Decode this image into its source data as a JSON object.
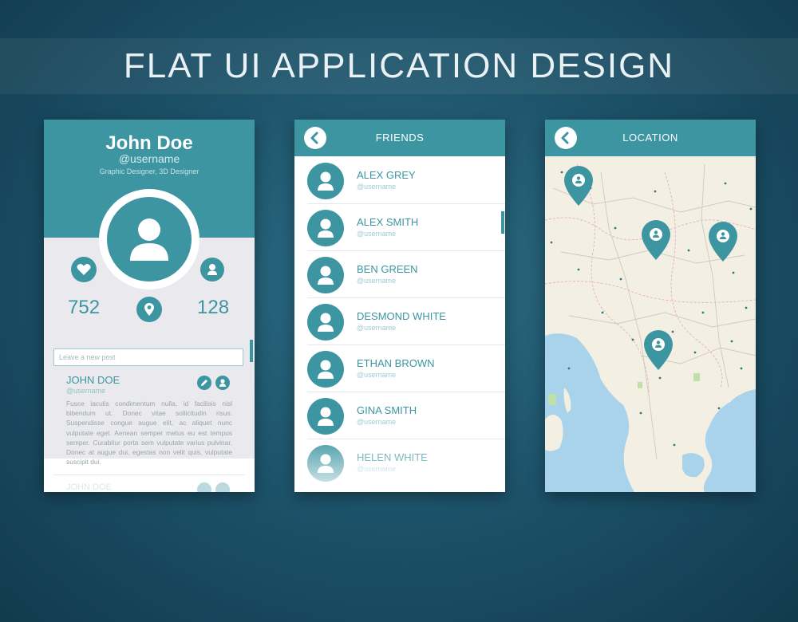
{
  "page": {
    "title": "FLAT UI APPLICATION DESIGN"
  },
  "profile": {
    "name": "John Doe",
    "handle": "@username",
    "role": "Graphic Designer, 3D Designer",
    "likes": "752",
    "followers": "128",
    "post_placeholder": "Leave a new post",
    "post": {
      "author": "JOHN DOE",
      "handle": "@username",
      "body": "Fusce iaculis condimentum nulla, id facilisis nisl bibendum ut. Donec vitae sollicitudin risus. Suspendisse congue augue elit, ac aliquet nunc vulputate eget. Aenean semper metus eu est tempus semper. Curabitur porta sem vulputate varius pulvinar. Donec at augue dui, egestas non velit quis, vulputate suscipit dui."
    },
    "next_post_author": "JOHN DOE"
  },
  "friends": {
    "title": "FRIENDS",
    "items": [
      {
        "name": "ALEX GREY",
        "handle": "@username"
      },
      {
        "name": "ALEX SMITH",
        "handle": "@username"
      },
      {
        "name": "BEN GREEN",
        "handle": "@username"
      },
      {
        "name": "DESMOND WHITE",
        "handle": "@username"
      },
      {
        "name": "ETHAN BROWN",
        "handle": "@username"
      },
      {
        "name": "GINA SMITH",
        "handle": "@username"
      },
      {
        "name": "HELEN WHITE",
        "handle": "@username"
      }
    ]
  },
  "location": {
    "title": "LOCATION"
  },
  "colors": {
    "accent": "#3c95a1",
    "panel": "#eaeaee",
    "background": "#1b4f66",
    "sea": "#a9d3ea",
    "land": "#f4efe3"
  },
  "icons": [
    "back-icon",
    "heart-icon",
    "user-icon",
    "location-pin-icon",
    "edit-icon",
    "map-marker-icon"
  ]
}
